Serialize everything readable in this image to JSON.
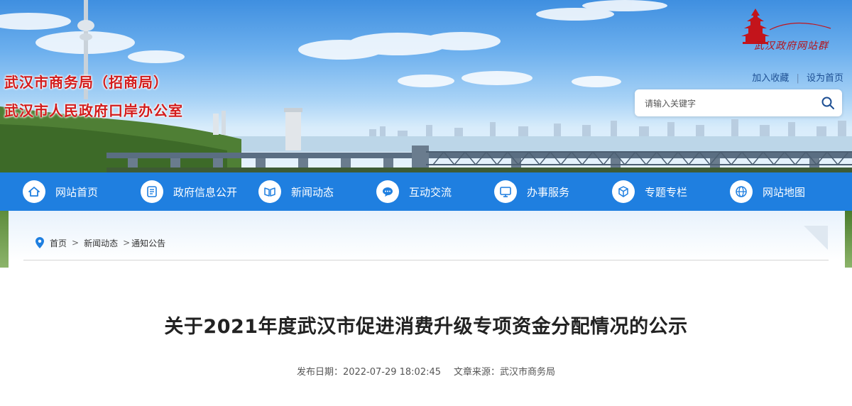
{
  "banner": {
    "title_line1": "武汉市商务局（招商局）",
    "title_line2": "武汉市人民政府口岸办公室",
    "portal_name": "武汉政府网站群",
    "links": {
      "favorite": "加入收藏",
      "separator": "|",
      "homepage": "设为首页"
    },
    "search": {
      "placeholder": "请输入关键字"
    }
  },
  "nav": {
    "items": [
      {
        "label": "网站首页",
        "icon": "home-icon"
      },
      {
        "label": "政府信息公开",
        "icon": "document-list-icon"
      },
      {
        "label": "新闻动态",
        "icon": "newspaper-icon"
      },
      {
        "label": "互动交流",
        "icon": "chat-icon"
      },
      {
        "label": "办事服务",
        "icon": "monitor-icon"
      },
      {
        "label": "专题专栏",
        "icon": "cube-icon"
      },
      {
        "label": "网站地图",
        "icon": "globe-icon"
      }
    ]
  },
  "breadcrumb": {
    "icon": "location-pin-icon",
    "items": [
      "首页",
      "新闻动态",
      "通知公告"
    ],
    "separator": ">"
  },
  "article": {
    "title": "关于2021年度武汉市促进消费升级专项资金分配情况的公示",
    "publish_label": "发布日期：",
    "publish_date": "2022-07-29 18:02:45",
    "source_label": "文章来源：",
    "source": "武汉市商务局"
  },
  "colors": {
    "nav_background": "#1f7fe0",
    "title_red": "#d31c1c",
    "link_blue": "#1d4f93"
  }
}
